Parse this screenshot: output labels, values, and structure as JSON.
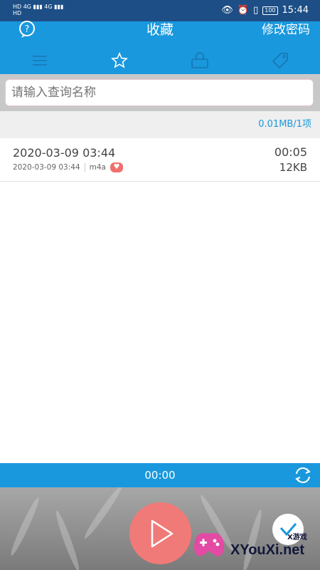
{
  "status_bar": {
    "left_line1": "HD 4G ▮▮▮ 4G ▮▮▮",
    "left_line2": "HD",
    "battery": "100",
    "time": "15:44"
  },
  "header": {
    "title": "收藏",
    "change_password": "修改密码",
    "help_icon": "question-icon"
  },
  "tabs": [
    {
      "icon": "list-icon"
    },
    {
      "icon": "star-icon"
    },
    {
      "icon": "lock-icon"
    },
    {
      "icon": "tag-icon"
    }
  ],
  "search": {
    "placeholder": "请输入查询名称"
  },
  "summary": "0.01MB/1项",
  "recordings": [
    {
      "title": "2020-03-09 03:44",
      "date": "2020-03-09 03:44",
      "format": "m4a",
      "duration": "00:05",
      "size": "12KB"
    }
  ],
  "player": {
    "time": "00:00"
  },
  "watermark": {
    "text": "XYouXi.net",
    "top": "X游戏"
  },
  "colors": {
    "accent": "#1a98dd",
    "status_bar": "#1d4f86",
    "play": "#f07a78"
  }
}
